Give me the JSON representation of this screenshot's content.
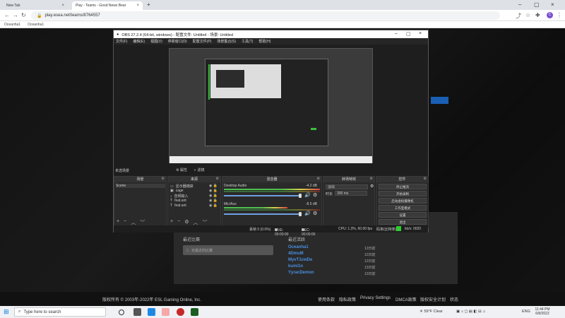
{
  "browser": {
    "tabs": [
      {
        "title": "New Tab"
      },
      {
        "title": "Play - Teams - Good News Bear"
      }
    ],
    "url": "play.esea.net/teams/8764557",
    "bookmarks": [
      "Oceanha1",
      "Oceanha1"
    ],
    "profile_initial": "C"
  },
  "obs": {
    "title": "OBS 27.2.4 (64-bit, windows) - 配置文件: Untitled - 场景: Untitled",
    "menu": [
      "文件(F)",
      "编辑(E)",
      "视图(V)",
      "停靠窗口(D)",
      "配置文件(P)",
      "场景集合(S)",
      "工具(T)",
      "帮助(H)"
    ],
    "toolbar": {
      "scene_label": "未选场景",
      "settings": "属性",
      "filters": "滤镜"
    },
    "scenes": {
      "header": "场景",
      "items": [
        "Scene"
      ]
    },
    "sources": {
      "header": "来源",
      "items": [
        "显示器捕获",
        "cage",
        "音频输入",
        "feat.ant",
        "feat.ant"
      ]
    },
    "mixer": {
      "header": "混音器",
      "channels": [
        {
          "name": "Desktop Audio",
          "db": "-4.2 dB"
        },
        {
          "name": "Mic/Aux",
          "db": "-8.5 dB"
        }
      ]
    },
    "transitions": {
      "header": "转场特效",
      "type": "淡出",
      "duration_label": "时长",
      "duration": "300 ms"
    },
    "controls": {
      "header": "控件",
      "buttons": [
        "停止推流",
        "开始录制",
        "启动虚拟摄像机",
        "工作室模式",
        "设置",
        "退出"
      ]
    },
    "status": {
      "dropped": "丢帧 0 (0.0%)",
      "live": "LIVE: 00:00:00",
      "rec": "REC: 00:00:00",
      "cpu": "CPU: 1.3%, 60.00 fps",
      "bitrate_label": "码率(比特率)",
      "kbps": "kb/s: 0020"
    }
  },
  "page": {
    "section_left_title": "最近比赛",
    "search_placeholder": "无最近的比赛",
    "section_right_title": "最近活跃",
    "players": [
      {
        "name": "Oceanha1",
        "stat": "12日前"
      },
      {
        "name": "4DmuM",
        "stat": "12日前"
      },
      {
        "name": "MyvT1cwDe",
        "stat": "12日前"
      },
      {
        "name": "kumi1n",
        "stat": "13日前"
      },
      {
        "name": "YyracDemon",
        "stat": "13日前"
      }
    ],
    "footer_copyright": "版权所有 © 2003年-2022年 ESL Gaming Online, Inc.",
    "footer_links": [
      "使用条款",
      "隐私政策",
      "Privacy Settings",
      "DMCA政策",
      "版权安全计划",
      "状态"
    ]
  },
  "taskbar": {
    "search_placeholder": "Type here to search",
    "weather": "59°F  Clear",
    "lang": "ENG",
    "time": "11:44 PM",
    "date": "6/8/2022"
  }
}
